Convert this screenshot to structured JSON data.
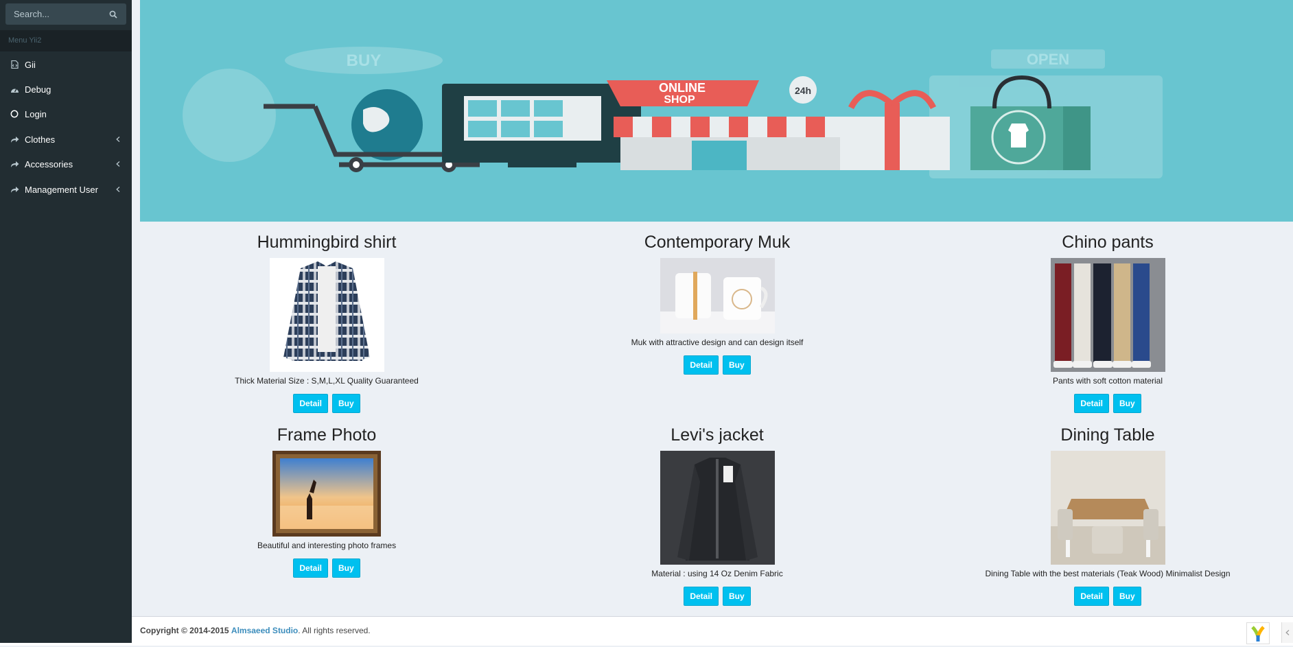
{
  "sidebar": {
    "search_placeholder": "Search...",
    "menu_header": "Menu Yii2",
    "items": [
      {
        "label": "Gii",
        "icon": "file-code-icon"
      },
      {
        "label": "Debug",
        "icon": "dashboard-icon"
      },
      {
        "label": "Login",
        "icon": "circle-icon"
      },
      {
        "label": "Clothes",
        "icon": "share-icon",
        "has_children": true
      },
      {
        "label": "Accessories",
        "icon": "share-icon",
        "has_children": true
      },
      {
        "label": "Management User",
        "icon": "share-icon",
        "has_children": true
      }
    ]
  },
  "banner": {
    "sign_buy": "BUY",
    "sign_online_shop_1": "ONLINE",
    "sign_online_shop_2": "SHOP",
    "sign_24h": "24h",
    "sign_open": "OPEN"
  },
  "products": [
    {
      "title": "Hummingbird shirt",
      "description": "Thick Material Size : S,M,L,XL Quality Guaranteed",
      "detail_label": "Detail",
      "buy_label": "Buy"
    },
    {
      "title": "Contemporary Muk",
      "description": "Muk with attractive design and can design itself",
      "detail_label": "Detail",
      "buy_label": "Buy"
    },
    {
      "title": "Chino pants",
      "description": "Pants with soft cotton material",
      "detail_label": "Detail",
      "buy_label": "Buy"
    },
    {
      "title": "Frame Photo",
      "description": "Beautiful and interesting photo frames",
      "detail_label": "Detail",
      "buy_label": "Buy"
    },
    {
      "title": "Levi's jacket",
      "description": "Material : using 14 Oz Denim Fabric",
      "detail_label": "Detail",
      "buy_label": "Buy"
    },
    {
      "title": "Dining Table",
      "description": "Dining Table with the best materials (Teak Wood) Minimalist Design",
      "detail_label": "Detail",
      "buy_label": "Buy"
    }
  ],
  "footer": {
    "copyright": "Copyright © 2014-2015",
    "studio": "Almsaeed Studio",
    "rights": ". All rights reserved."
  },
  "colors": {
    "sidebar_bg": "#222d32",
    "banner_bg": "#68c5d0",
    "button_bg": "#00c0ef",
    "content_bg": "#ecf0f5",
    "link": "#3c8dbc"
  }
}
